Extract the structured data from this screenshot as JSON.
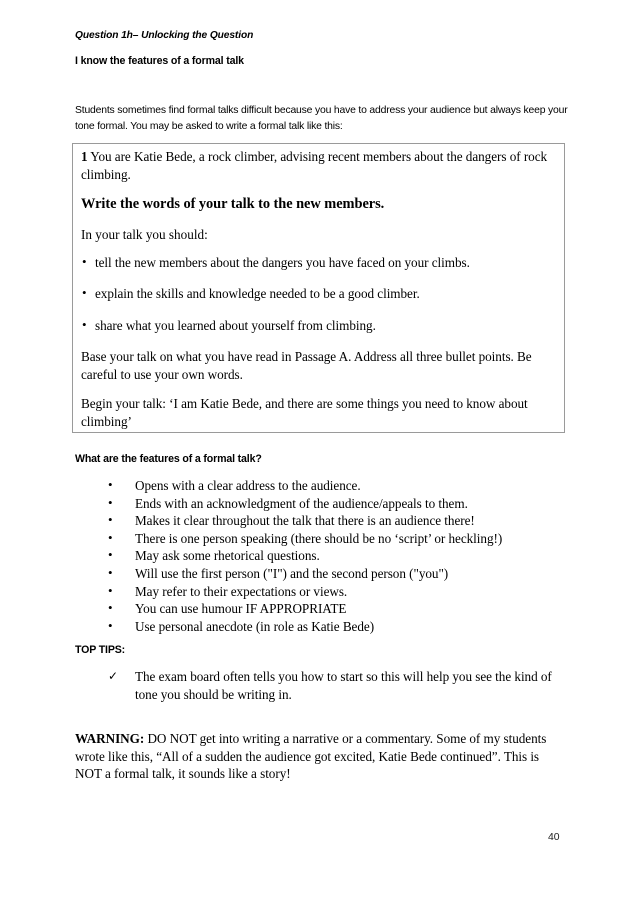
{
  "document": {
    "header": {
      "question_label": "Question 1h– Unlocking the Question",
      "objective": "I know the features of a formal talk"
    },
    "intro_paragraph": "Students sometimes find formal talks difficult because you have to address your audience but always keep your tone formal. You may be asked to write a formal talk like this:",
    "question_box": {
      "number": "1",
      "scenario": " You are Katie Bede, a rock climber, advising recent members about the dangers of rock climbing.",
      "instruction": "Write the words of your talk to the new members.",
      "list_lead_in": "In your talk you should:",
      "bullets": [
        "tell the new members about the dangers you have faced on your climbs.",
        "explain the skills and knowledge needed to be a good climber.",
        "share what you learned about yourself from climbing."
      ],
      "closing_paragraph": "Base your talk on what you have read in Passage A. Address all three bullet points. Be careful to use your own words.",
      "opening_line": "Begin your talk: ‘I am Katie Bede, and there are some things you need to know about climbing’"
    },
    "features": {
      "heading": "What are the features of a formal talk?",
      "items": [
        "Opens with a clear address to the audience.",
        "Ends with an acknowledgment of the audience/appeals to them.",
        "Makes it clear throughout the talk that there is an audience there!",
        "There is one person speaking (there should be no ‘script’ or heckling!)",
        "May ask some rhetorical questions.",
        "Will use the first person (\"I\") and the second person (\"you\")",
        "May refer to their expectations or views.",
        "You can use humour IF APPROPRIATE",
        "Use personal anecdote (in role as Katie Bede)"
      ]
    },
    "top_tips": {
      "heading": "TOP TIPS:",
      "items": [
        "The exam board often tells you how to start so this will help you see the kind of tone you should be writing in."
      ]
    },
    "warning": {
      "label": "WARNING:",
      "text": " DO NOT get into writing a narrative or a commentary. Some of my students wrote like this, “All of a sudden the audience got excited, Katie Bede continued”. This is NOT a formal talk, it sounds like a story!"
    },
    "page_number": "40"
  }
}
